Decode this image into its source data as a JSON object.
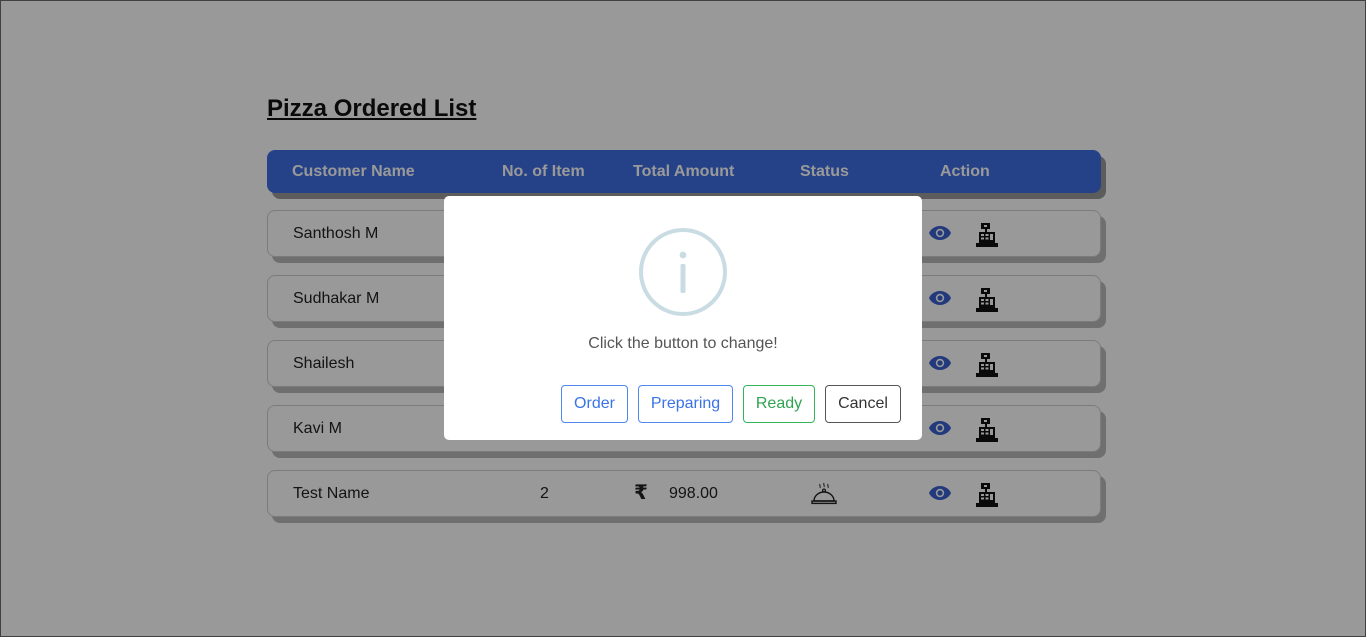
{
  "page": {
    "title": "Pizza Ordered List"
  },
  "table": {
    "headers": [
      "Customer Name",
      "No. of Item",
      "Total Amount",
      "Status",
      "Action"
    ],
    "rows": [
      {
        "customer": "Santhosh M",
        "items": "",
        "amount": ""
      },
      {
        "customer": "Sudhakar M",
        "items": "",
        "amount": ""
      },
      {
        "customer": "Shailesh",
        "items": "",
        "amount": ""
      },
      {
        "customer": "Kavi M",
        "items": "",
        "amount": ""
      },
      {
        "customer": "Test Name",
        "items": "2",
        "amount": "998.00",
        "currency_symbol": "₹",
        "status_icon": "serving-cloche-icon"
      }
    ],
    "action_icons": [
      "eye-icon",
      "cash-register-icon"
    ]
  },
  "modal": {
    "icon": "info-icon",
    "message": "Click the button to change!",
    "buttons": {
      "order": "Order",
      "preparing": "Preparing",
      "ready": "Ready",
      "cancel": "Cancel"
    }
  },
  "colors": {
    "header_bg": "#3f6fe3",
    "action_icon": "#3a5fcf",
    "order_btn": "#3a73e6",
    "ready_btn": "#2fa350",
    "info_icon": "#c9dbe3"
  }
}
